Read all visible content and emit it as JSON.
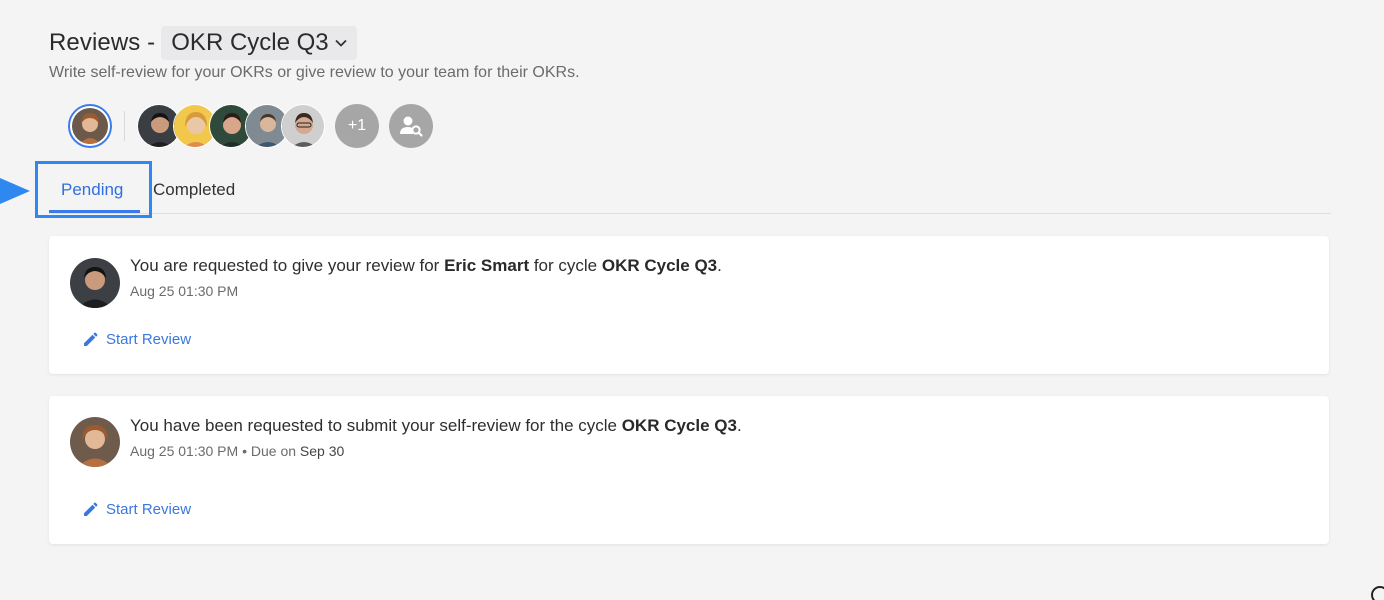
{
  "header": {
    "title_prefix": "Reviews - ",
    "cycle": "OKR Cycle Q3",
    "subtitle": "Write self-review for your OKRs or give review to your team for their OKRs."
  },
  "people": {
    "more_count": "+1"
  },
  "tabs": [
    {
      "label": "Pending",
      "active": true
    },
    {
      "label": "Completed",
      "active": false
    }
  ],
  "reviews": [
    {
      "pre": "You are requested to give your review for ",
      "person": "Eric Smart",
      "mid": " for cycle ",
      "cycle": "OKR Cycle Q3",
      "post": ".",
      "time": "Aug 25 01:30 PM",
      "action": "Start Review"
    },
    {
      "pre": "You have been requested to submit your self-review for the cycle ",
      "cycle": "OKR Cycle Q3",
      "post": ".",
      "time": "Aug 25 01:30 PM",
      "sep": " • ",
      "due_label": "Due on ",
      "due_date": "Sep 30",
      "action": "Start Review"
    }
  ],
  "colors": {
    "accent": "#3a7be8",
    "highlight": "#2f88f0",
    "background": "#f4f4f5"
  }
}
